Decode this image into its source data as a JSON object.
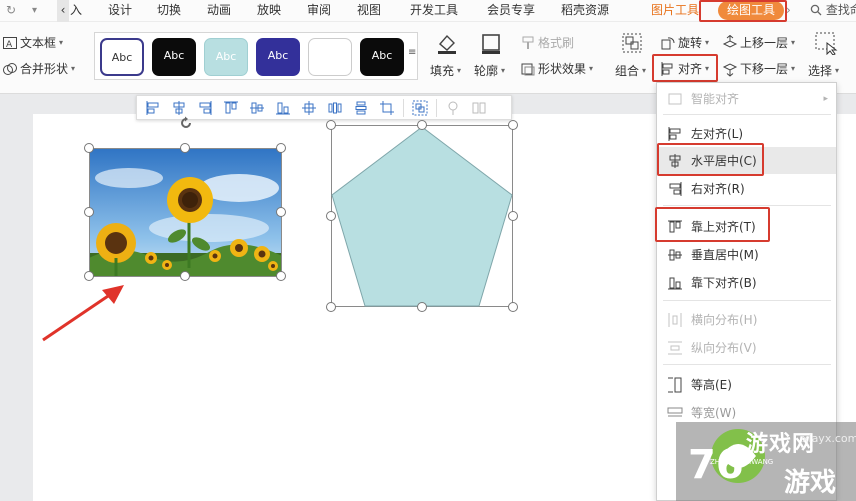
{
  "menubar": {
    "tabs": [
      "入",
      "设计",
      "切换",
      "动画",
      "放映",
      "审阅",
      "视图",
      "开发工具",
      "会员专享",
      "稻壳资源"
    ],
    "picture_tools": "图片工具",
    "drawing_tools": "绘图工具",
    "search": "查找命"
  },
  "toolbar": {
    "text_box": "文本框",
    "merge_shapes": "合并形状",
    "style_swatch_label": "Abc",
    "fill": "填充",
    "outline": "轮廓",
    "format_brush": "格式刷",
    "shape_effects": "形状效果",
    "combine": "组合",
    "rotate": "旋转",
    "align": "对齐",
    "bring_forward": "上移一层",
    "send_backward": "下移一层",
    "select": "选择"
  },
  "align_menu": {
    "smart_align": "智能对齐",
    "align_left": "左对齐(L)",
    "center_horizontal": "水平居中(C)",
    "align_right": "右对齐(R)",
    "align_top": "靠上对齐(T)",
    "center_vertical": "垂直居中(M)",
    "align_bottom": "靠下对齐(B)",
    "distribute_horizontal": "横向分布(H)",
    "distribute_vertical": "纵向分布(V)",
    "same_height": "等高(E)",
    "same_width": "等宽(W)"
  },
  "watermark": {
    "text_top": "游戏网",
    "text_bottom": "游戏",
    "domain": "xiayx.com",
    "pinyin": "ZHAOYOUXIWANG"
  },
  "colors": {
    "accent_orange": "#f08a3c",
    "highlight_red": "#d63b2f",
    "pentagon_fill": "#b8dfe1",
    "arrow_red": "#e0332a"
  }
}
